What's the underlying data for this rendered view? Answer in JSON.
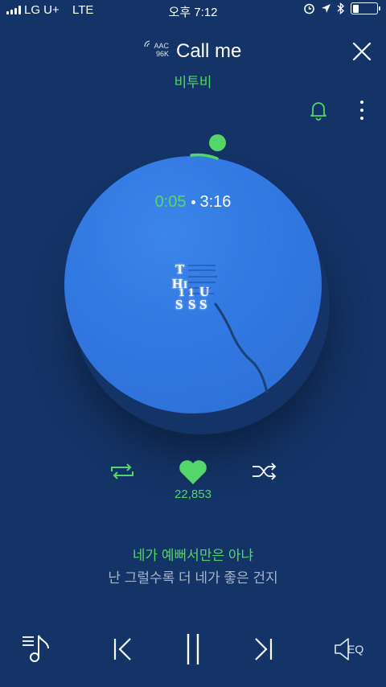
{
  "status_bar": {
    "carrier": "LG U+",
    "network": "LTE",
    "time": "오후 7:12",
    "battery_level": 0.25
  },
  "header": {
    "codec": "AAC",
    "bitrate": "96K",
    "title": "Call me",
    "artist": "비투비"
  },
  "player": {
    "elapsed": "0:05",
    "total": "3:16",
    "progress": 0.026,
    "like_count": "22,853",
    "liked": true
  },
  "lyrics": {
    "current": "네가 예뻐서만은 아냐",
    "next": "난 그럴수록 더 네가 좋은 건지"
  },
  "controls": {
    "eq_label": "EQ"
  },
  "colors": {
    "background": "#143366",
    "disc": "#3178e0",
    "accent": "#53d769",
    "text_dim": "#a8b6cc"
  },
  "icons": [
    "signal-icon",
    "alarm-icon",
    "location-icon",
    "bluetooth-icon",
    "battery-icon",
    "close-icon",
    "bell-icon",
    "more-icon",
    "repeat-icon",
    "heart-icon",
    "shuffle-icon",
    "playlist-icon",
    "previous-icon",
    "pause-icon",
    "next-icon",
    "speaker-icon"
  ]
}
